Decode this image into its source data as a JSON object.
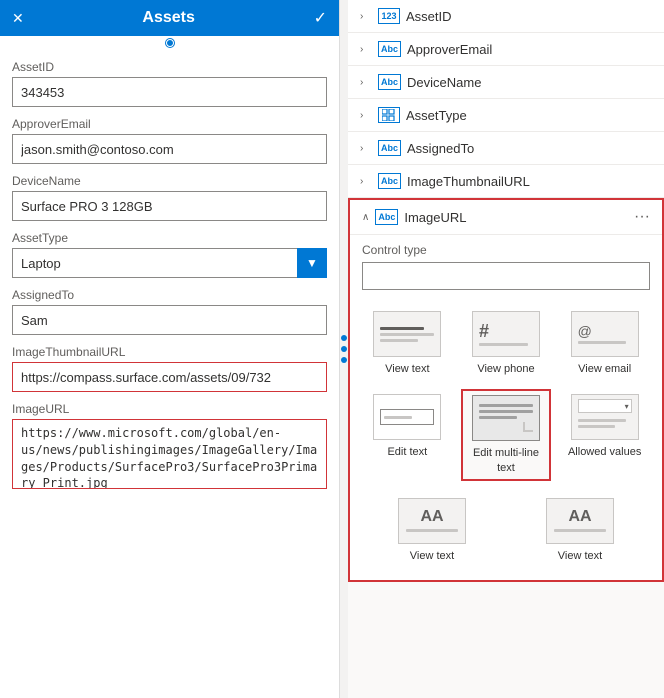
{
  "leftPanel": {
    "title": "Assets",
    "fields": [
      {
        "id": "assetid",
        "label": "AssetID",
        "value": "343453",
        "type": "input",
        "highlighted": false
      },
      {
        "id": "approveremail",
        "label": "ApproverEmail",
        "value": "jason.smith@contoso.com",
        "type": "input",
        "highlighted": false
      },
      {
        "id": "devicename",
        "label": "DeviceName",
        "value": "Surface PRO 3 128GB",
        "type": "input",
        "highlighted": false
      },
      {
        "id": "assettype",
        "label": "AssetType",
        "value": "Laptop",
        "type": "select",
        "highlighted": false
      },
      {
        "id": "assignedto",
        "label": "AssignedTo",
        "value": "Sam",
        "type": "input",
        "highlighted": false
      },
      {
        "id": "imagethumbnailurl",
        "label": "ImageThumbnailURL",
        "value": "https://compass.surface.com/assets/09/732",
        "type": "input",
        "highlighted": true
      },
      {
        "id": "imageurl",
        "label": "ImageURL",
        "value": "https://www.microsoft.com/global/en-us/news/publishingimages/ImageGallery/Images/Products/SurfacePro3/SurfacePro3Primary_Print.jpg",
        "type": "textarea",
        "highlighted": true
      }
    ]
  },
  "rightPanel": {
    "fieldList": [
      {
        "id": "assetid",
        "name": "AssetID",
        "typeBadge": "123",
        "hasChevron": true
      },
      {
        "id": "approveremail",
        "name": "ApproverEmail",
        "typeBadge": "Abc",
        "hasChevron": true
      },
      {
        "id": "devicename",
        "name": "DeviceName",
        "typeBadge": "Abc",
        "hasChevron": true
      },
      {
        "id": "assettype",
        "name": "AssetType",
        "typeBadge": "##",
        "hasChevron": true
      },
      {
        "id": "assignedto",
        "name": "AssignedTo",
        "typeBadge": "Abc",
        "hasChevron": true
      },
      {
        "id": "imagethumbnailurl",
        "name": "ImageThumbnailURL",
        "typeBadge": "Abc",
        "hasChevron": true
      }
    ],
    "expandedSection": {
      "name": "ImageURL",
      "typeBadge": "Abc",
      "controlTypeLabel": "Control type",
      "controlTypeValue": "",
      "controls": [
        {
          "id": "view-text",
          "label": "View text",
          "type": "view-text"
        },
        {
          "id": "view-phone",
          "label": "View phone",
          "type": "view-phone"
        },
        {
          "id": "view-email",
          "label": "View email",
          "type": "view-email"
        },
        {
          "id": "edit-text",
          "label": "Edit text",
          "type": "edit-text"
        },
        {
          "id": "edit-multiline",
          "label": "Edit multi-line text",
          "type": "edit-multiline",
          "selected": true
        },
        {
          "id": "allowed-values",
          "label": "Allowed values",
          "type": "allowed-values"
        }
      ],
      "bottomControls": [
        {
          "id": "view-text-2",
          "label": "View text",
          "type": "view-text-large"
        },
        {
          "id": "view-text-3",
          "label": "View text",
          "type": "view-text-large-2"
        }
      ]
    }
  }
}
